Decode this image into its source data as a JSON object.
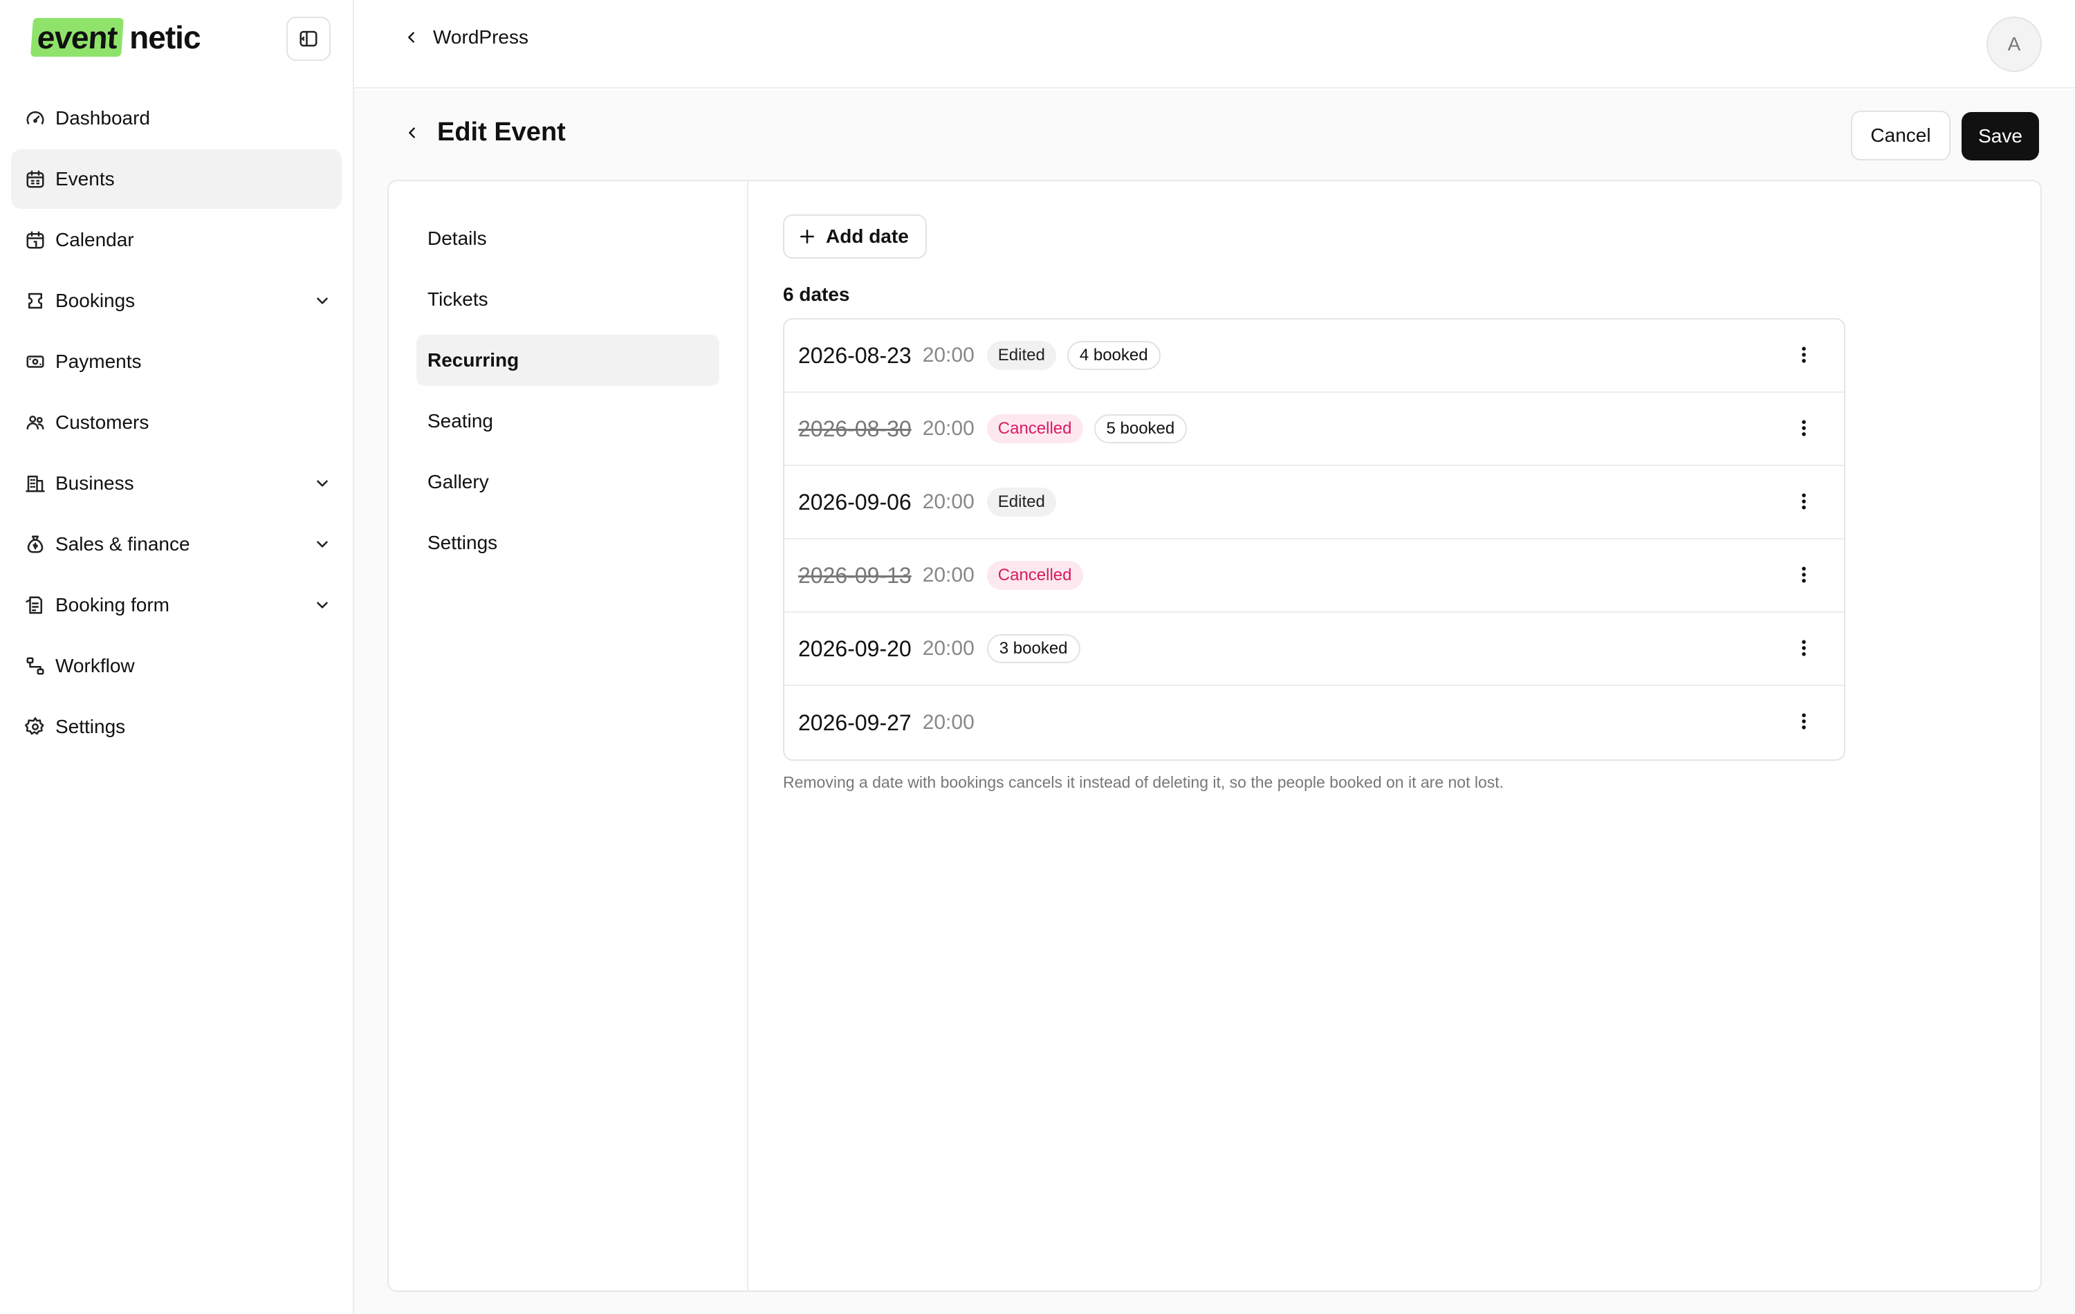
{
  "brand": {
    "logo_highlight": "event",
    "logo_rest": "netic"
  },
  "sidebar": {
    "items": [
      {
        "label": "Dashboard",
        "icon": "gauge-icon",
        "active": false,
        "expandable": false
      },
      {
        "label": "Events",
        "icon": "calendar-icon",
        "active": true,
        "expandable": false
      },
      {
        "label": "Calendar",
        "icon": "calendar-date-icon",
        "active": false,
        "expandable": false
      },
      {
        "label": "Bookings",
        "icon": "ticket-icon",
        "active": false,
        "expandable": true
      },
      {
        "label": "Payments",
        "icon": "banknote-icon",
        "active": false,
        "expandable": false
      },
      {
        "label": "Customers",
        "icon": "users-icon",
        "active": false,
        "expandable": false
      },
      {
        "label": "Business",
        "icon": "building-icon",
        "active": false,
        "expandable": true
      },
      {
        "label": "Sales & finance",
        "icon": "money-bag-icon",
        "active": false,
        "expandable": true
      },
      {
        "label": "Booking form",
        "icon": "form-icon",
        "active": false,
        "expandable": true
      },
      {
        "label": "Workflow",
        "icon": "workflow-icon",
        "active": false,
        "expandable": false
      },
      {
        "label": "Settings",
        "icon": "gear-icon",
        "active": false,
        "expandable": false
      }
    ]
  },
  "topbar": {
    "back_label": "WordPress",
    "avatar_initial": "A"
  },
  "page": {
    "title": "Edit Event",
    "cancel_label": "Cancel",
    "save_label": "Save"
  },
  "subnav": {
    "items": [
      {
        "label": "Details",
        "active": false
      },
      {
        "label": "Tickets",
        "active": false
      },
      {
        "label": "Recurring",
        "active": true
      },
      {
        "label": "Seating",
        "active": false
      },
      {
        "label": "Gallery",
        "active": false
      },
      {
        "label": "Settings",
        "active": false
      }
    ]
  },
  "recurring": {
    "add_label": "Add date",
    "count_label": "6 dates",
    "dates": [
      {
        "date": "2026-08-23",
        "time": "20:00",
        "cancelled": false,
        "badges": [
          {
            "text": "Edited",
            "kind": "edited"
          },
          {
            "text": "4 booked",
            "kind": "booked"
          }
        ]
      },
      {
        "date": "2026-08-30",
        "time": "20:00",
        "cancelled": true,
        "badges": [
          {
            "text": "Cancelled",
            "kind": "cancel"
          },
          {
            "text": "5 booked",
            "kind": "booked"
          }
        ]
      },
      {
        "date": "2026-09-06",
        "time": "20:00",
        "cancelled": false,
        "badges": [
          {
            "text": "Edited",
            "kind": "edited"
          }
        ]
      },
      {
        "date": "2026-09-13",
        "time": "20:00",
        "cancelled": true,
        "badges": [
          {
            "text": "Cancelled",
            "kind": "cancel"
          }
        ]
      },
      {
        "date": "2026-09-20",
        "time": "20:00",
        "cancelled": false,
        "badges": [
          {
            "text": "3 booked",
            "kind": "booked"
          }
        ]
      },
      {
        "date": "2026-09-27",
        "time": "20:00",
        "cancelled": false,
        "badges": []
      }
    ],
    "note": "Removing a date with bookings cancels it instead of deleting it, so the people booked on it are not lost."
  },
  "colors": {
    "accent": "#8fe36a",
    "primary": "#111111",
    "cancel": "#d81b60",
    "cancel_bg": "#fde8ef"
  }
}
